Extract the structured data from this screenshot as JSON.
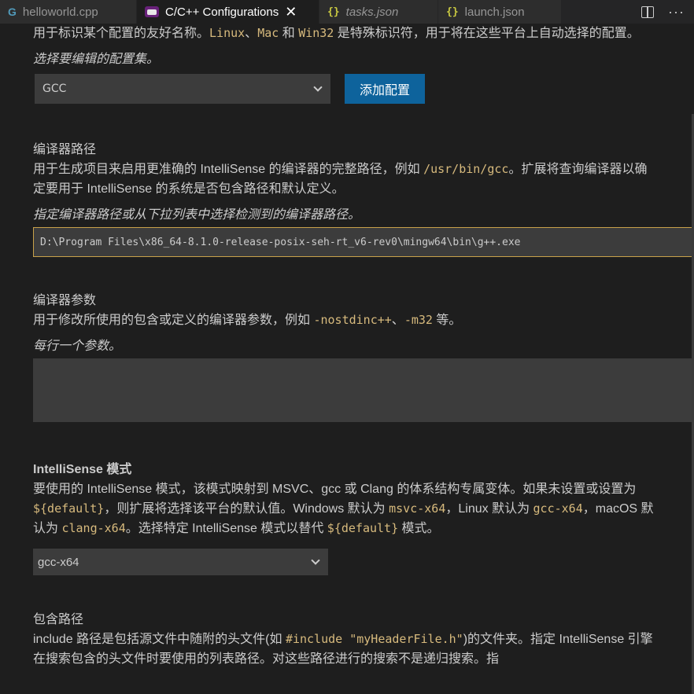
{
  "tabs": [
    {
      "label": "helloworld.cpp",
      "icon": "cpp-file-icon",
      "active": false,
      "italic": false
    },
    {
      "label": "C/C++ Configurations",
      "icon": "vs-extension-icon",
      "active": true,
      "italic": false
    },
    {
      "label": "tasks.json",
      "icon": "json-file-icon",
      "active": false,
      "italic": true
    },
    {
      "label": "launch.json",
      "icon": "json-file-icon",
      "active": false,
      "italic": false
    }
  ],
  "tab_glyphs": {
    "cpp": "G",
    "json": "{}",
    "close": "✕",
    "more": "···"
  },
  "config_name": {
    "desc_1": "用于标识某个配置的友好名称。",
    "code_linux": "Linux",
    "sep_1": "、",
    "code_mac": "Mac",
    "and": " 和 ",
    "code_win32": "Win32",
    "desc_2": " 是特殊标识符，用于将在这些平台上自动选择的配置。",
    "hint": "选择要编辑的配置集。",
    "selected": "GCC",
    "add_button": "添加配置"
  },
  "compiler_path": {
    "title": "编译器路径",
    "desc_1": "用于生成项目来启用更准确的 IntelliSense 的编译器的完整路径，例如 ",
    "code_example": "/usr/bin/gcc",
    "desc_2": "。扩展将查询编译器以确定要用于 IntelliSense 的系统是否包含路径和默认定义。",
    "hint": "指定编译器路径或从下拉列表中选择检测到的编译器路径。",
    "value": "D:\\Program Files\\x86_64-8.1.0-release-posix-seh-rt_v6-rev0\\mingw64\\bin\\g++.exe"
  },
  "compiler_args": {
    "title": "编译器参数",
    "desc_1": "用于修改所使用的包含或定义的编译器参数，例如 ",
    "code_1": "-nostdinc++",
    "sep": "、",
    "code_2": "-m32",
    "desc_2": " 等。",
    "hint": "每行一个参数。",
    "value": ""
  },
  "intellisense_mode": {
    "title": "IntelliSense 模式",
    "desc_1": "要使用的 IntelliSense 模式，该模式映射到 MSVC、gcc 或 Clang 的体系结构专属变体。如果未设置或设置为 ",
    "code_default_1": "${default}",
    "desc_2": "，则扩展将选择该平台的默认值。Windows 默认为 ",
    "code_msvc": "msvc-x64",
    "desc_3": "，Linux 默认为 ",
    "code_gcc": "gcc-x64",
    "desc_4": "，macOS 默认为 ",
    "code_clang": "clang-x64",
    "desc_5": "。选择特定 IntelliSense 模式以替代 ",
    "code_default_2": "${default}",
    "desc_6": " 模式。",
    "selected": "gcc-x64"
  },
  "include_path": {
    "title": "包含路径",
    "desc_1": "include 路径是包括源文件中随附的头文件(如 ",
    "code_include": "#include \"myHeaderFile.h\"",
    "desc_2": ")的文件夹。指定 IntelliSense 引擎在搜索包含的头文件时要使用的列表路径。对这些路径进行的搜索不是递归搜索。指"
  }
}
